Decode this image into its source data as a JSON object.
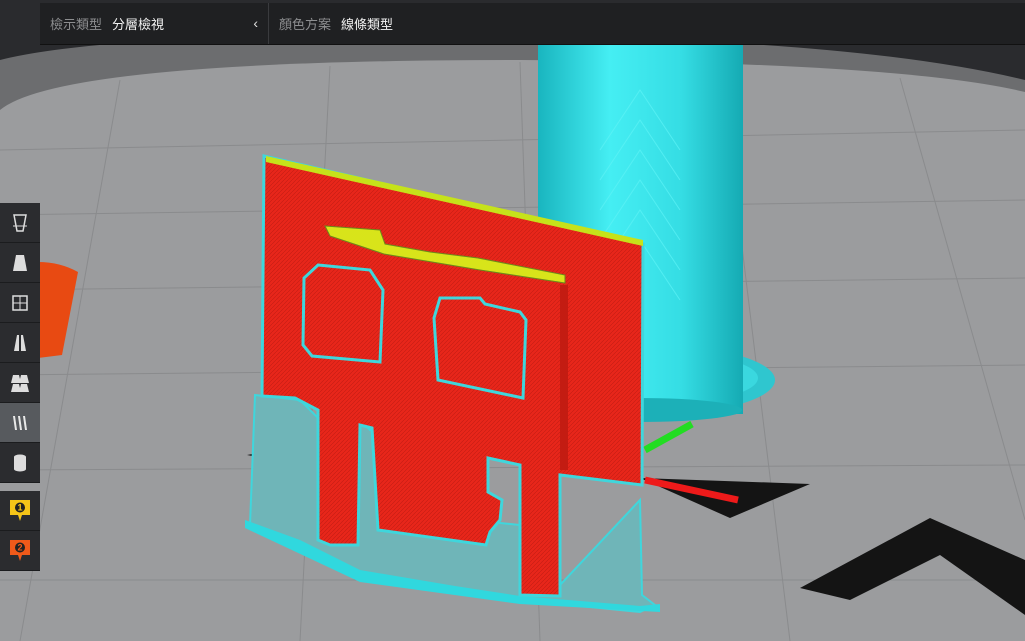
{
  "header": {
    "view_type_label": "檢示類型",
    "view_type_value": "分層檢視",
    "color_scheme_label": "顏色方案",
    "color_scheme_value": "線條類型"
  },
  "markers": [
    {
      "number": "1",
      "color": "#f5c518"
    },
    {
      "number": "2",
      "color": "#f05a1a"
    }
  ],
  "icons": [
    "view-3d-icon",
    "view-front-icon",
    "view-top-icon",
    "view-left-icon",
    "view-right-icon",
    "layer-view-icon",
    "cylinder-icon"
  ],
  "colors": {
    "wall_outer": "#e8261a",
    "wall_inner": "#3fd2de",
    "support": "#1fd8df",
    "infill_top": "#d8e41a",
    "skirt": "#2ee0e6",
    "build_plate": "#9a9b9d"
  }
}
